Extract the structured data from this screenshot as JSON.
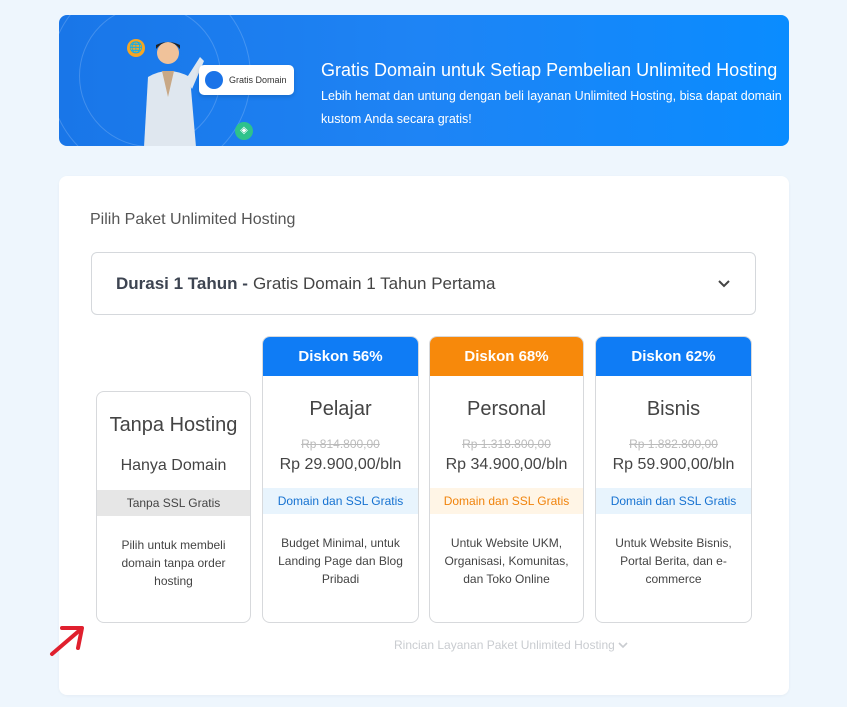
{
  "banner": {
    "chip_label": "Gratis Domain",
    "title": "Gratis Domain untuk Setiap Pembelian Unlimited Hosting",
    "description": "Lebih hemat dan untung dengan beli layanan Unlimited Hosting, bisa dapat domain kustom Anda secara gratis!"
  },
  "card": {
    "label": "Pilih Paket Unlimited Hosting",
    "dropdown": {
      "bold": "Durasi 1 Tahun -",
      "text": "Gratis Domain 1 Tahun Pertama"
    },
    "plans": [
      {
        "name": "Tanpa Hosting",
        "subtitle": "Hanya Domain",
        "ssl": "Tanpa SSL Gratis",
        "desc": "Pilih untuk membeli domain tanpa order hosting"
      },
      {
        "badge": "Diskon 56%",
        "name": "Pelajar",
        "old_price": "Rp 814.800,00",
        "price": "Rp 29.900,00/bln",
        "ssl": "Domain dan SSL Gratis",
        "desc": "Budget Minimal, untuk Landing Page dan Blog Pribadi"
      },
      {
        "badge": "Diskon 68%",
        "name": "Personal",
        "old_price": "Rp 1.318.800,00",
        "price": "Rp 34.900,00/bln",
        "ssl": "Domain dan SSL Gratis",
        "desc": "Untuk Website UKM, Organisasi, Komunitas, dan Toko Online"
      },
      {
        "badge": "Diskon 62%",
        "name": "Bisnis",
        "old_price": "Rp 1.882.800,00",
        "price": "Rp 59.900,00/bln",
        "ssl": "Domain dan SSL Gratis",
        "desc": "Untuk Website Bisnis, Portal Berita, dan e-commerce"
      }
    ],
    "details_link": "Rincian Layanan Paket Unlimited Hosting"
  },
  "colors": {
    "blue": "#0f7cf5",
    "orange": "#f7890b",
    "arrow": "#e0202e"
  },
  "icons": [
    "globe-icon",
    "tag-icon",
    "domain-icon",
    "chevron-down-icon",
    "red-arrow-icon"
  ]
}
